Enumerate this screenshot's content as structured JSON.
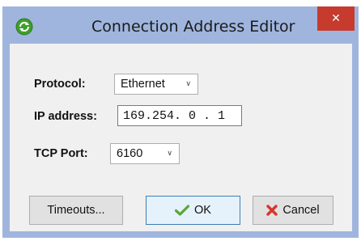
{
  "window": {
    "title": "Connection Address Editor",
    "close_symbol": "✕",
    "app_icon": "green-refresh-icon"
  },
  "form": {
    "protocol_label": "Protocol:",
    "protocol_value": "Ethernet",
    "ip_label": "IP address:",
    "ip_value": "169.254. 0 . 1",
    "port_label": "TCP Port:",
    "port_value": "6160"
  },
  "buttons": {
    "timeouts_label": "Timeouts...",
    "ok_label": "OK",
    "cancel_label": "Cancel"
  },
  "colors": {
    "titlebar": "#9fb5de",
    "close": "#c63b2e",
    "ok_check": "#5aa83a",
    "cancel_x": "#d9342b"
  }
}
